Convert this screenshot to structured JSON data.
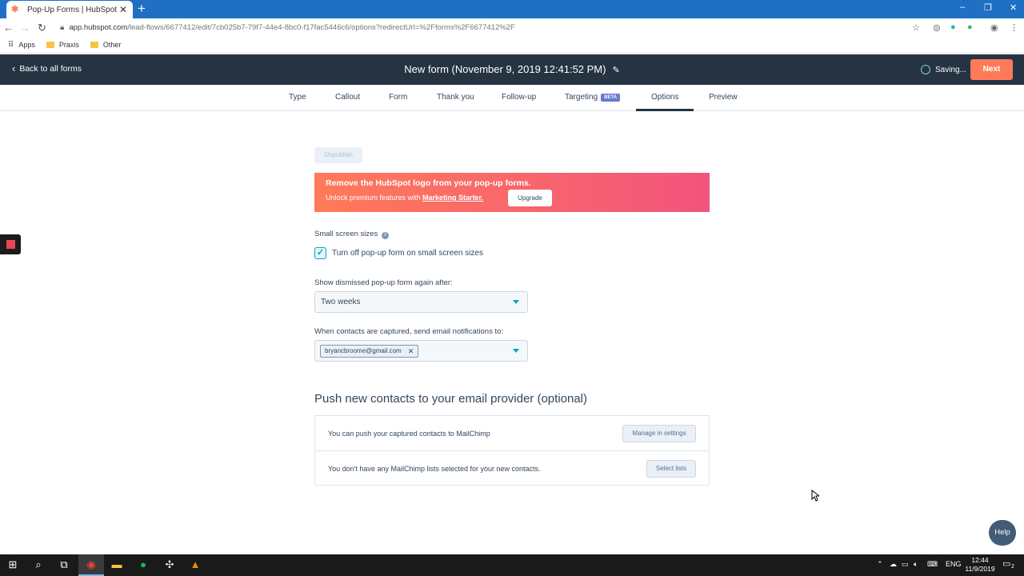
{
  "browser": {
    "tab_title": "Pop-Up Forms | HubSpot",
    "url_host": "app.hubspot.com",
    "url_path": "/lead-flows/6677412/edit/7cb025b7-79f7-44e4-8bc0-f17fac5446c6/options?redirectUrl=%2Fforms%2F6677412%2F",
    "bookmarks": [
      "Apps",
      "Praxis",
      "Other"
    ]
  },
  "header": {
    "back_label": "Back to all forms",
    "title": "New form (November 9, 2019 12:41:52 PM)",
    "saving_label": "Saving...",
    "next_label": "Next"
  },
  "steps": {
    "type": "Type",
    "callout": "Callout",
    "form": "Form",
    "thank_you": "Thank you",
    "follow_up": "Follow-up",
    "targeting": "Targeting",
    "targeting_badge": "BETA",
    "options": "Options",
    "preview": "Preview",
    "active": "Options"
  },
  "main": {
    "unpublish_label": "Unpublish",
    "banner": {
      "title": "Remove the HubSpot logo from your pop-up forms.",
      "sub_prefix": "Unlock premium features with ",
      "sub_link": "Marketing Starter.",
      "upgrade_label": "Upgrade"
    },
    "small_screen": {
      "label": "Small screen sizes",
      "checkbox_label": "Turn off pop-up form on small screen sizes",
      "checked": true
    },
    "dismissed": {
      "label": "Show dismissed pop-up form again after:",
      "value": "Two weeks"
    },
    "notifications": {
      "label": "When contacts are captured, send email notifications to:",
      "chip": "bryancbroome@gmail.com"
    },
    "push": {
      "heading": "Push new contacts to your email provider (optional)",
      "row1_text": "You can push your captured contacts to MailChimp",
      "row1_button": "Manage in settings",
      "row2_text": "You don't have any MailChimp lists selected for your new contacts.",
      "row2_button": "Select lists"
    }
  },
  "help_label": "Help",
  "taskbar": {
    "lang": "ENG",
    "time": "12:44",
    "date": "11/9/2019",
    "notification_count": "2"
  },
  "colors": {
    "header_bg": "#253342",
    "accent_orange": "#ff7a59",
    "teal": "#00a4bd",
    "beta_badge": "#6a78d1"
  }
}
